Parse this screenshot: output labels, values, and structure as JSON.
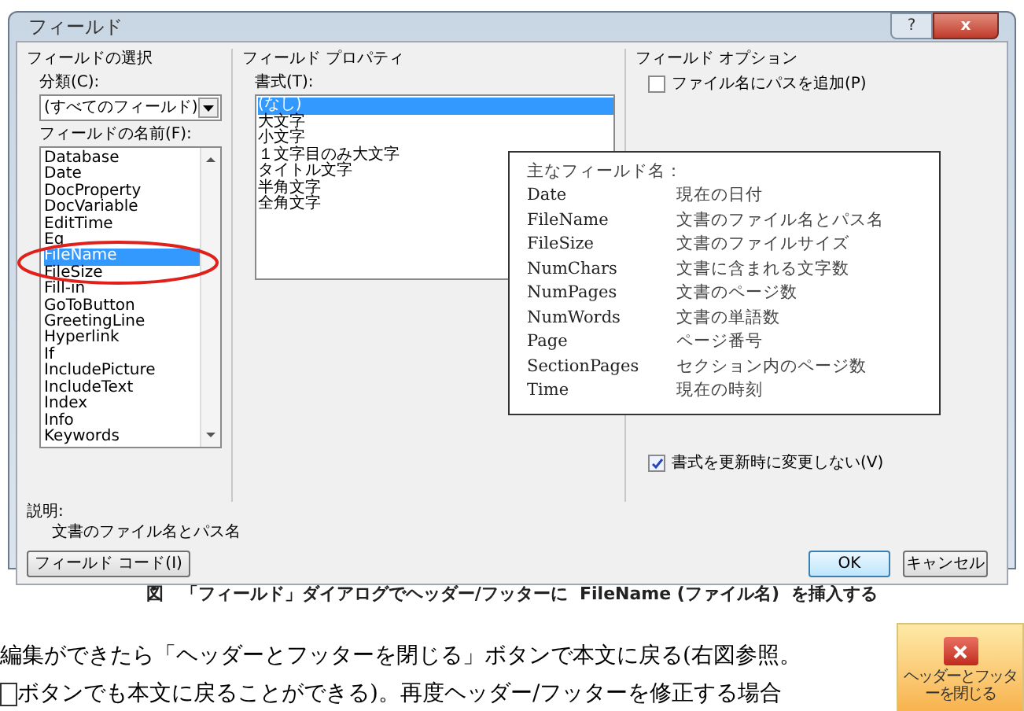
{
  "dialog": {
    "title": "フィールド",
    "help_button": "?",
    "close_button": "x",
    "field_selection": {
      "heading": "フィールドの選択",
      "category_label": "分類(C):",
      "category_value": "(すべてのフィールド)",
      "names_label": "フィールドの名前(F):",
      "names": [
        {
          "label": "Database",
          "selected": false
        },
        {
          "label": "Date",
          "selected": false
        },
        {
          "label": "DocProperty",
          "selected": false
        },
        {
          "label": "DocVariable",
          "selected": false
        },
        {
          "label": "EditTime",
          "selected": false
        },
        {
          "label": "Eq",
          "selected": false
        },
        {
          "label": "FileName",
          "selected": true
        },
        {
          "label": "FileSize",
          "selected": false
        },
        {
          "label": "Fill-in",
          "selected": false
        },
        {
          "label": "GoToButton",
          "selected": false
        },
        {
          "label": "GreetingLine",
          "selected": false
        },
        {
          "label": "Hyperlink",
          "selected": false
        },
        {
          "label": "If",
          "selected": false
        },
        {
          "label": "IncludePicture",
          "selected": false
        },
        {
          "label": "IncludeText",
          "selected": false
        },
        {
          "label": "Index",
          "selected": false
        },
        {
          "label": "Info",
          "selected": false
        },
        {
          "label": "Keywords",
          "selected": false
        }
      ]
    },
    "field_properties": {
      "heading": "フィールド プロパティ",
      "format_label": "書式(T):",
      "formats": [
        {
          "label": "(なし)",
          "selected": true
        },
        {
          "label": "大文字",
          "selected": false
        },
        {
          "label": "小文字",
          "selected": false
        },
        {
          "label": "１文字目のみ大文字",
          "selected": false
        },
        {
          "label": "タイトル文字",
          "selected": false
        },
        {
          "label": "半角文字",
          "selected": false
        },
        {
          "label": "全角文字",
          "selected": false
        }
      ]
    },
    "field_options": {
      "heading": "フィールド オプション",
      "checkboxes": [
        {
          "label": "ファイル名にパスを追加(P)",
          "checked": false
        },
        {
          "label": "書式を更新時に変更しない(V)",
          "checked": true
        }
      ]
    },
    "description_label": "説明:",
    "description": "文書のファイル名とパス名",
    "field_code_button": "フィールド コード(I)",
    "ok_button": "OK",
    "cancel_button": "キャンセル"
  },
  "callout": {
    "title": "主なフィールド名：",
    "rows": [
      {
        "name": "Date",
        "meaning": "現在の日付"
      },
      {
        "name": "FileName",
        "meaning": "文書のファイル名とパス名"
      },
      {
        "name": "FileSize",
        "meaning": "文書のファイルサイズ"
      },
      {
        "name": "NumChars",
        "meaning": "文書に含まれる文字数"
      },
      {
        "name": "NumPages",
        "meaning": "文書のページ数"
      },
      {
        "name": "NumWords",
        "meaning": "文書の単語数"
      },
      {
        "name": "Page",
        "meaning": "ページ番号"
      },
      {
        "name": "SectionPages",
        "meaning": "セクション内のページ数"
      },
      {
        "name": "Time",
        "meaning": "現在の時刻"
      }
    ]
  },
  "caption": "図　「フィールド」ダイアログでヘッダー/フッターに  FileName (ファイル名)  を挿入する",
  "body_lines": [
    "編集ができたら「ヘッダーとフッターを閉じる」ボタンで本文に戻る(右図参照。",
    "ボタンでも本文に戻ることができる)。再度ヘッダー/フッターを修正する場合"
  ],
  "side_button": {
    "label": "ヘッダーとフッターを閉じる"
  }
}
